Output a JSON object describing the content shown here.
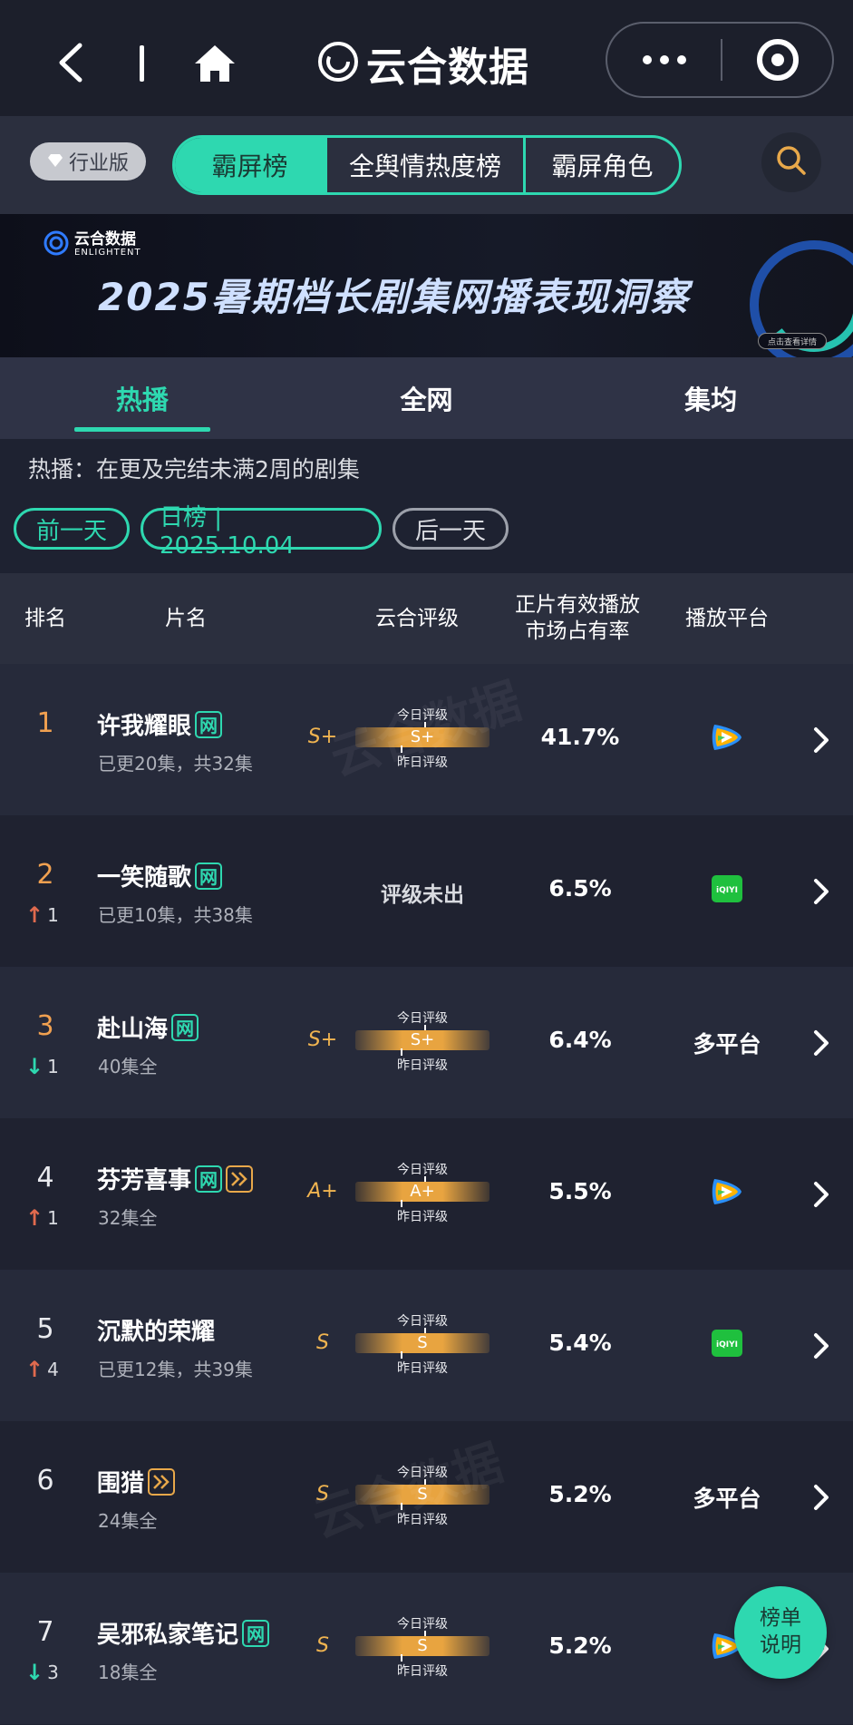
{
  "topbar": {
    "brand": "云合数据"
  },
  "filters": {
    "edition": "行业版",
    "segments": [
      "霸屏榜",
      "全舆情热度榜",
      "霸屏角色"
    ]
  },
  "banner": {
    "logo_name": "云合数据",
    "logo_sub": "ENLIGHTENT",
    "headline": "2025暑期档长剧集网播表现洞察",
    "cta": "点击查看详情"
  },
  "tabs": [
    "热播",
    "全网",
    "集均"
  ],
  "note": "热播：在更及完结未满2周的剧集",
  "date": {
    "prev": "前一天",
    "current": "日榜 | 2025.10.04",
    "next": "后一天"
  },
  "table": {
    "headers": {
      "rank": "排名",
      "title": "片名",
      "grade": "云合评级",
      "share_line1": "正片有效播放",
      "share_line2": "市场占有率",
      "platform": "播放平台"
    },
    "grade_labels": {
      "today": "今日评级",
      "yesterday": "昨日评级"
    },
    "rows": [
      {
        "rank": "1",
        "change_dir": "",
        "change": "",
        "title": "许我耀眼",
        "tag_net": "网",
        "tag_play": false,
        "sub": "已更20集，共32集",
        "grade": "S+",
        "today_grade": "S+",
        "no_grade": "",
        "share": "41.7%",
        "platform_text": "",
        "platform_icon": "tencent-video"
      },
      {
        "rank": "2",
        "change_dir": "up",
        "change": "1",
        "title": "一笑随歌",
        "tag_net": "网",
        "tag_play": false,
        "sub": "已更10集，共38集",
        "grade": "",
        "today_grade": "",
        "no_grade": "评级未出",
        "share": "6.5%",
        "platform_text": "",
        "platform_icon": "iqiyi"
      },
      {
        "rank": "3",
        "change_dir": "down",
        "change": "1",
        "title": "赴山海",
        "tag_net": "网",
        "tag_play": false,
        "sub": "40集全",
        "grade": "S+",
        "today_grade": "S+",
        "no_grade": "",
        "share": "6.4%",
        "platform_text": "多平台",
        "platform_icon": ""
      },
      {
        "rank": "4",
        "change_dir": "up",
        "change": "1",
        "title": "芬芳喜事",
        "tag_net": "网",
        "tag_play": true,
        "sub": "32集全",
        "grade": "A+",
        "today_grade": "A+",
        "no_grade": "",
        "share": "5.5%",
        "platform_text": "",
        "platform_icon": "tencent-video"
      },
      {
        "rank": "5",
        "change_dir": "up",
        "change": "4",
        "title": "沉默的荣耀",
        "tag_net": "",
        "tag_play": false,
        "sub": "已更12集，共39集",
        "grade": "S",
        "today_grade": "S",
        "no_grade": "",
        "share": "5.4%",
        "platform_text": "",
        "platform_icon": "iqiyi"
      },
      {
        "rank": "6",
        "change_dir": "",
        "change": "",
        "title": "围猎",
        "tag_net": "",
        "tag_play": true,
        "sub": "24集全",
        "grade": "S",
        "today_grade": "S",
        "no_grade": "",
        "share": "5.2%",
        "platform_text": "多平台",
        "platform_icon": ""
      },
      {
        "rank": "7",
        "change_dir": "down",
        "change": "3",
        "title": "吴邪私家笔记",
        "tag_net": "网",
        "tag_play": false,
        "sub": "18集全",
        "grade": "S",
        "today_grade": "S",
        "no_grade": "",
        "share": "5.2%",
        "platform_text": "",
        "platform_icon": "tencent-video"
      }
    ]
  },
  "explain_button": {
    "line1": "榜单",
    "line2": "说明"
  },
  "colors": {
    "accent": "#2ed8b0",
    "grade": "#f0b450",
    "up": "#e06a4e",
    "rank_top": "#f0a050",
    "background": "#1e2231"
  }
}
